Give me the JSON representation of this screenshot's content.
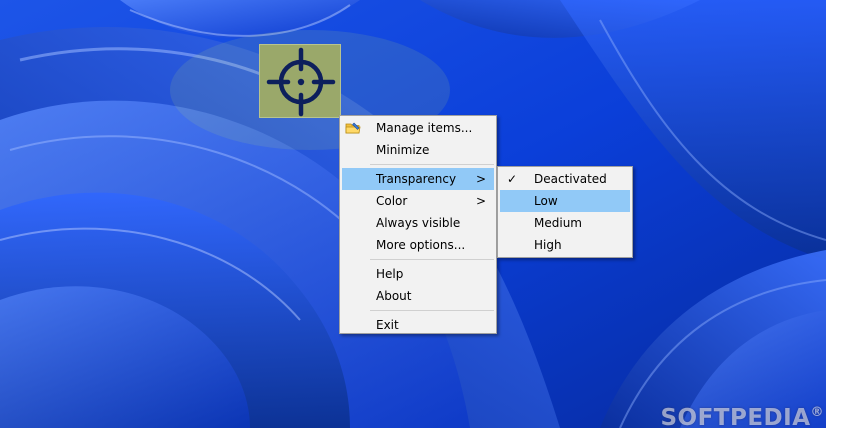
{
  "main_menu": {
    "items": [
      {
        "label": "Manage items...",
        "icon": "folder-edit-icon"
      },
      {
        "label": "Minimize"
      },
      {
        "label": "Transparency",
        "submenu": true
      },
      {
        "label": "Color",
        "submenu": true
      },
      {
        "label": "Always visible"
      },
      {
        "label": "More options..."
      },
      {
        "label": "Help"
      },
      {
        "label": "About"
      },
      {
        "label": "Exit"
      }
    ],
    "highlighted": "Transparency",
    "submenu_arrow": ">"
  },
  "transparency_submenu": {
    "items": [
      {
        "label": "Deactivated",
        "checked": true
      },
      {
        "label": "Low"
      },
      {
        "label": "Medium"
      },
      {
        "label": "High"
      }
    ],
    "highlighted": "Low",
    "check_glyph": "✓"
  },
  "widget": {
    "icon": "crosshair-icon",
    "background_color": "#9aa86a",
    "icon_color": "#0d1f5c"
  },
  "watermark": {
    "text": "SOFTPEDIA",
    "mark": "®"
  },
  "colors": {
    "menu_background": "#f2f2f2",
    "menu_highlight": "#91c9f7",
    "wallpaper_base": "#0a3ad8"
  }
}
